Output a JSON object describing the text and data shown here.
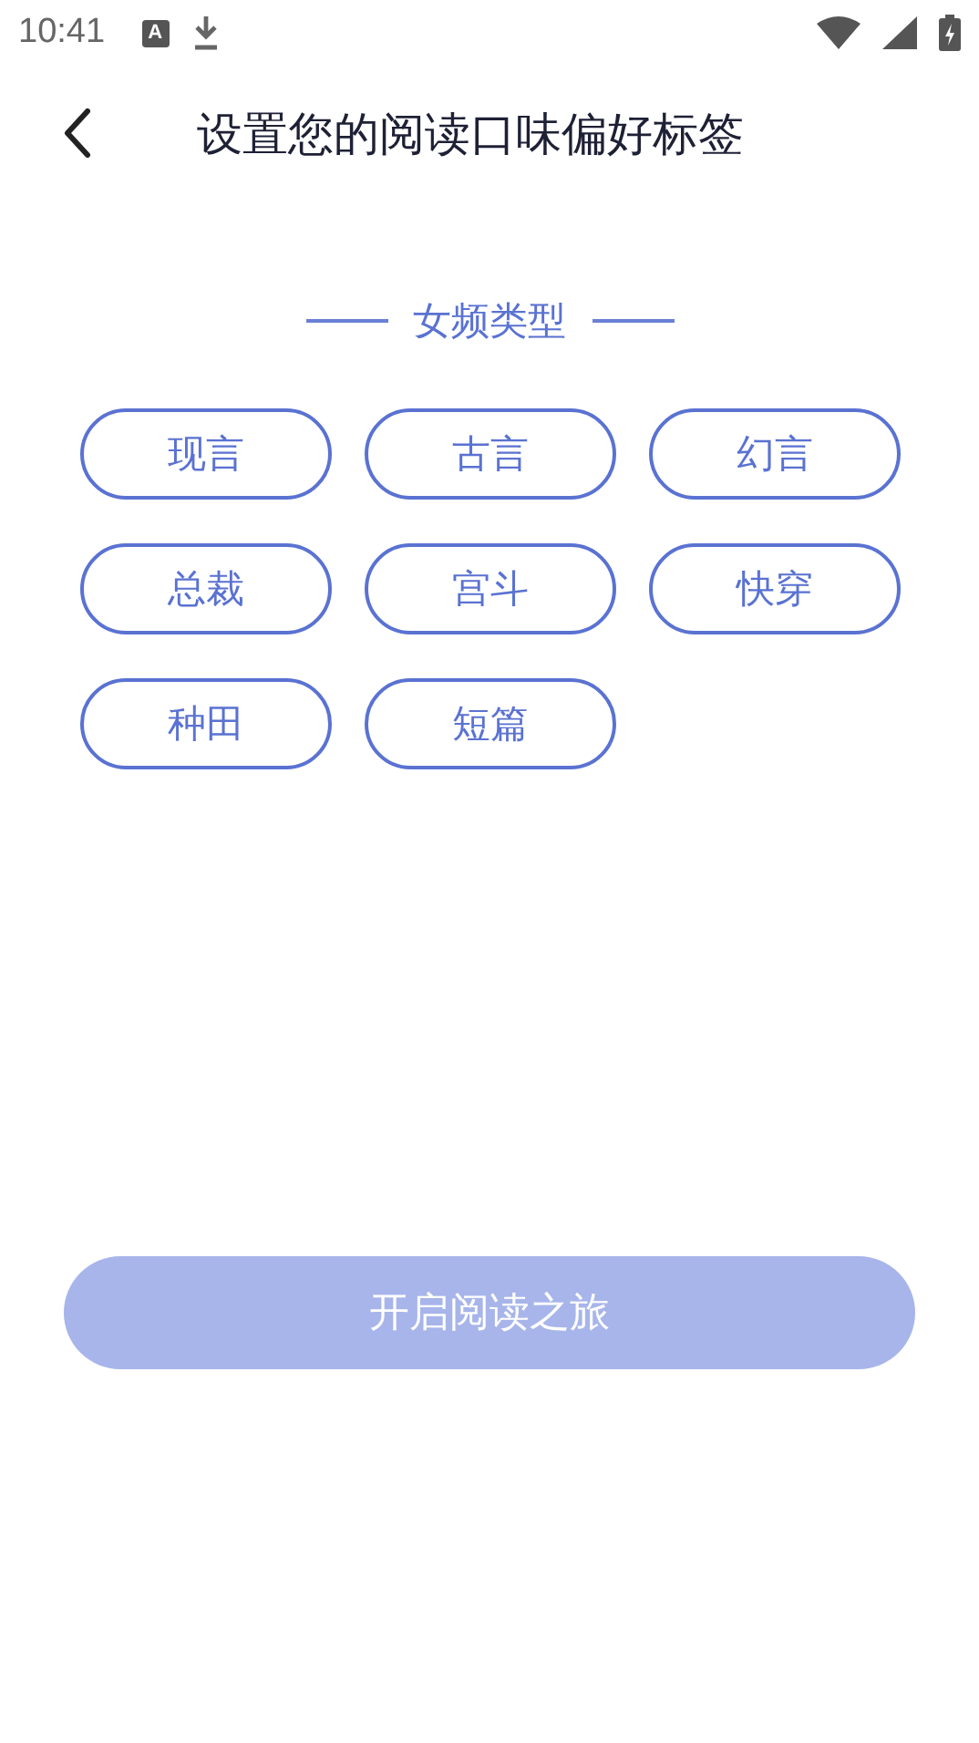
{
  "status_bar": {
    "time": "10:41",
    "keyboard_badge": "A"
  },
  "header": {
    "title": "设置您的阅读口味偏好标签"
  },
  "section": {
    "title": "女频类型"
  },
  "tags": [
    {
      "label": "现言",
      "selected": false
    },
    {
      "label": "古言",
      "selected": false
    },
    {
      "label": "幻言",
      "selected": false
    },
    {
      "label": "总裁",
      "selected": false
    },
    {
      "label": "宫斗",
      "selected": false
    },
    {
      "label": "快穿",
      "selected": false
    },
    {
      "label": "种田",
      "selected": false
    },
    {
      "label": "短篇",
      "selected": false
    }
  ],
  "start_button": {
    "label": "开启阅读之旅",
    "disabled": true
  }
}
